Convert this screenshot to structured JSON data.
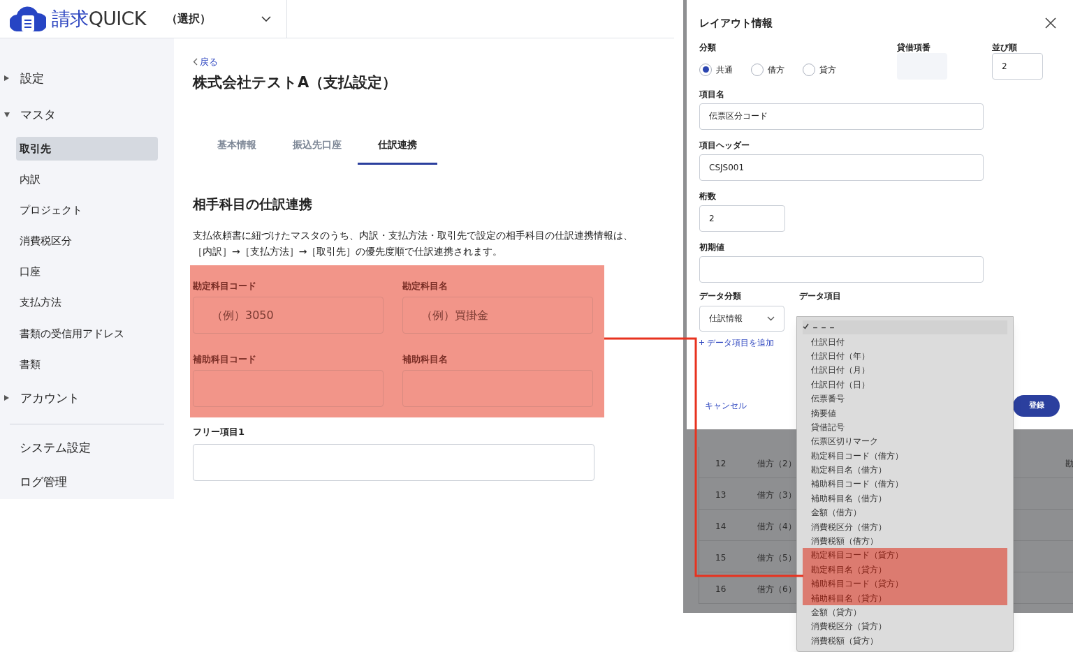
{
  "header": {
    "logo_first": "請求",
    "logo_second": "QUICK",
    "selector": "（選択）"
  },
  "sidebar": {
    "items": [
      {
        "kind": "group",
        "label": "設定",
        "expanded": false
      },
      {
        "kind": "group",
        "label": "マスタ",
        "expanded": true
      },
      {
        "kind": "item",
        "label": "取引先",
        "selected": true
      },
      {
        "kind": "item",
        "label": "内訳",
        "selected": false
      },
      {
        "kind": "item",
        "label": "プロジェクト",
        "selected": false
      },
      {
        "kind": "item",
        "label": "消費税区分",
        "selected": false
      },
      {
        "kind": "item",
        "label": "口座",
        "selected": false
      },
      {
        "kind": "item",
        "label": "支払方法",
        "selected": false
      },
      {
        "kind": "item",
        "label": "書類の受信用アドレス",
        "selected": false
      },
      {
        "kind": "item",
        "label": "書類",
        "selected": false
      },
      {
        "kind": "group",
        "label": "アカウント",
        "expanded": false
      },
      {
        "kind": "divider"
      },
      {
        "kind": "top",
        "label": "システム設定"
      },
      {
        "kind": "top",
        "label": "ログ管理"
      }
    ]
  },
  "main": {
    "back": "戻る",
    "title": "株式会社テストA（支払設定）",
    "tabs": [
      {
        "label": "基本情報",
        "selected": false
      },
      {
        "label": "振込先口座",
        "selected": false
      },
      {
        "label": "仕訳連携",
        "selected": true
      }
    ],
    "section_title": "相手科目の仕訳連携",
    "description": [
      "支払依頼書に紐づけたマスタのうち、内訳・支払方法・取引先で設定の相手科目の仕訳連携情報は、",
      "［内訳］→［支払方法］→［取引先］の優先度順で仕訳連携されます。"
    ],
    "highlighted_fields": [
      {
        "label": "勘定科目コード",
        "placeholder": "（例）3050"
      },
      {
        "label": "勘定科目名",
        "placeholder": "（例）買掛金"
      },
      {
        "label": "補助科目コード"
      },
      {
        "label": "補助科目名"
      }
    ],
    "fields": [
      {
        "label": "フリー項目1"
      }
    ]
  },
  "background_table": {
    "rows": [
      [
        "12",
        "借方（2）",
        "勘"
      ],
      [
        "13",
        "借方（3）"
      ],
      [
        "14",
        "借方（4）"
      ],
      [
        "15",
        "借方（5）"
      ],
      [
        "16",
        "借方（6）"
      ]
    ]
  },
  "modal": {
    "title": "レイアウト情報",
    "classification": {
      "label": "分類",
      "options": [
        {
          "label": "共通",
          "selected": true
        },
        {
          "label": "借方",
          "selected": false
        },
        {
          "label": "貸方",
          "selected": false
        }
      ]
    },
    "dc_number": {
      "label": "貸借項番",
      "disabled": true
    },
    "order": {
      "label": "並び順",
      "value": "2"
    },
    "item_name": {
      "label": "項目名",
      "value": "伝票区分コード"
    },
    "item_header": {
      "label": "項目ヘッダー",
      "value": "CSJS001"
    },
    "digits": {
      "label": "桁数",
      "value": "2"
    },
    "initial_value": {
      "label": "初期値"
    },
    "data_category": {
      "label": "データ分類",
      "value": "仕訳情報"
    },
    "data_item": {
      "label": "データ項目"
    },
    "add_link": "データ項目を追加",
    "cancel": "キャンセル",
    "submit": "登録"
  },
  "dropdown": {
    "options": [
      {
        "label": "－－－",
        "selected": true,
        "highlighted": false
      },
      {
        "label": "仕訳日付",
        "selected": false,
        "highlighted": false
      },
      {
        "label": "仕訳日付（年）",
        "selected": false,
        "highlighted": false
      },
      {
        "label": "仕訳日付（月）",
        "selected": false,
        "highlighted": false
      },
      {
        "label": "仕訳日付（日）",
        "selected": false,
        "highlighted": false
      },
      {
        "label": "伝票番号",
        "selected": false,
        "highlighted": false
      },
      {
        "label": "摘要値",
        "selected": false,
        "highlighted": false
      },
      {
        "label": "貸借記号",
        "selected": false,
        "highlighted": false
      },
      {
        "label": "伝票区切りマーク",
        "selected": false,
        "highlighted": false
      },
      {
        "label": "勘定科目コード（借方）",
        "selected": false,
        "highlighted": false
      },
      {
        "label": "勘定科目名（借方）",
        "selected": false,
        "highlighted": false
      },
      {
        "label": "補助科目コード（借方）",
        "selected": false,
        "highlighted": false
      },
      {
        "label": "補助科目名（借方）",
        "selected": false,
        "highlighted": false
      },
      {
        "label": "金額（借方）",
        "selected": false,
        "highlighted": false
      },
      {
        "label": "消費税区分（借方）",
        "selected": false,
        "highlighted": false
      },
      {
        "label": "消費税額（借方）",
        "selected": false,
        "highlighted": false
      },
      {
        "label": "勘定科目コード（貸方）",
        "selected": false,
        "highlighted": true
      },
      {
        "label": "勘定科目名（貸方）",
        "selected": false,
        "highlighted": true
      },
      {
        "label": "補助科目コード（貸方）",
        "selected": false,
        "highlighted": true
      },
      {
        "label": "補助科目名（貸方）",
        "selected": false,
        "highlighted": true
      },
      {
        "label": "金額（貸方）",
        "selected": false,
        "highlighted": false
      },
      {
        "label": "消費税区分（貸方）",
        "selected": false,
        "highlighted": false
      },
      {
        "label": "消費税額（貸方）",
        "selected": false,
        "highlighted": false
      }
    ]
  }
}
